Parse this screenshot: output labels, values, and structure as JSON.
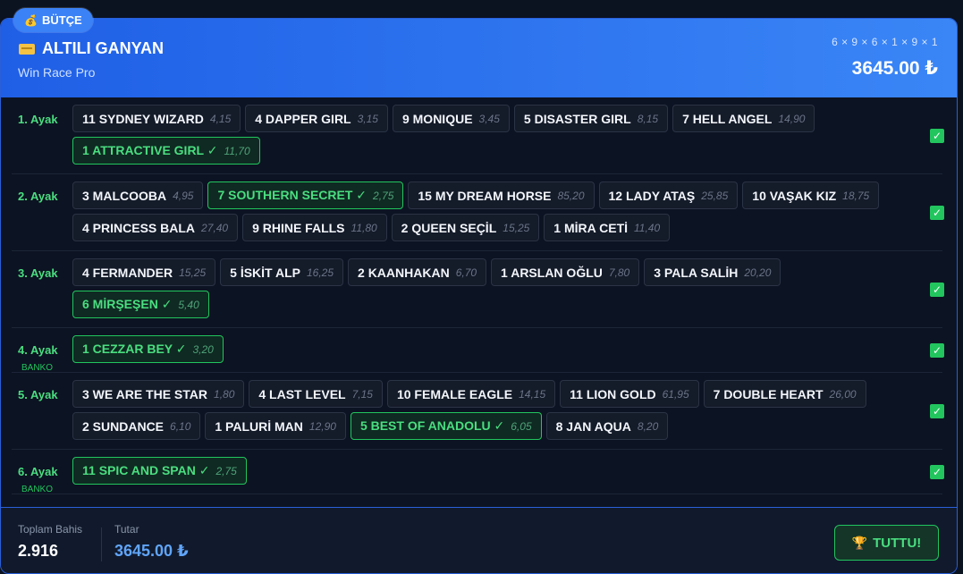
{
  "badge": {
    "icon": "💰",
    "label": "BÜTÇE"
  },
  "header": {
    "title": "ALTILI GANYAN",
    "subtitle": "Win Race Pro",
    "formula": "6 × 9 × 6 × 1 × 9 × 1",
    "total": "3645.00 ₺"
  },
  "legs": [
    {
      "label": "1. Ayak",
      "sub": "",
      "checked": true,
      "horses": [
        {
          "name": "11 SYDNEY WIZARD",
          "odds": "4,15",
          "selected": false
        },
        {
          "name": "4 DAPPER GIRL",
          "odds": "3,15",
          "selected": false
        },
        {
          "name": "9 MONIQUE",
          "odds": "3,45",
          "selected": false
        },
        {
          "name": "5 DISASTER GIRL",
          "odds": "8,15",
          "selected": false
        },
        {
          "name": "7 HELL ANGEL",
          "odds": "14,90",
          "selected": false
        },
        {
          "name": "1 ATTRACTIVE GIRL ✓",
          "odds": "11,70",
          "selected": true
        }
      ]
    },
    {
      "label": "2. Ayak",
      "sub": "",
      "checked": true,
      "horses": [
        {
          "name": "3 MALCOOBA",
          "odds": "4,95",
          "selected": false
        },
        {
          "name": "7 SOUTHERN SECRET ✓",
          "odds": "2,75",
          "selected": true
        },
        {
          "name": "15 MY DREAM HORSE",
          "odds": "85,20",
          "selected": false
        },
        {
          "name": "12 LADY ATAŞ",
          "odds": "25,85",
          "selected": false
        },
        {
          "name": "10 VAŞAK KIZ",
          "odds": "18,75",
          "selected": false
        },
        {
          "name": "4 PRINCESS BALA",
          "odds": "27,40",
          "selected": false
        },
        {
          "name": "9 RHINE FALLS",
          "odds": "11,80",
          "selected": false
        },
        {
          "name": "2 QUEEN SEÇİL",
          "odds": "15,25",
          "selected": false
        },
        {
          "name": "1 MİRA CETİ",
          "odds": "11,40",
          "selected": false
        }
      ]
    },
    {
      "label": "3. Ayak",
      "sub": "",
      "checked": true,
      "horses": [
        {
          "name": "4 FERMANDER",
          "odds": "15,25",
          "selected": false
        },
        {
          "name": "5 İSKİT ALP",
          "odds": "16,25",
          "selected": false
        },
        {
          "name": "2 KAANHAKAN",
          "odds": "6,70",
          "selected": false
        },
        {
          "name": "1 ARSLAN OĞLU",
          "odds": "7,80",
          "selected": false
        },
        {
          "name": "3 PALA SALİH",
          "odds": "20,20",
          "selected": false
        },
        {
          "name": "6 MİRŞEŞEN ✓",
          "odds": "5,40",
          "selected": true
        }
      ]
    },
    {
      "label": "4. Ayak",
      "sub": "BANKO",
      "checked": true,
      "horses": [
        {
          "name": "1 CEZZAR BEY ✓",
          "odds": "3,20",
          "selected": true
        }
      ]
    },
    {
      "label": "5. Ayak",
      "sub": "",
      "checked": true,
      "horses": [
        {
          "name": "3 WE ARE THE STAR",
          "odds": "1,80",
          "selected": false
        },
        {
          "name": "4 LAST LEVEL",
          "odds": "7,15",
          "selected": false
        },
        {
          "name": "10 FEMALE EAGLE",
          "odds": "14,15",
          "selected": false
        },
        {
          "name": "11 LION GOLD",
          "odds": "61,95",
          "selected": false
        },
        {
          "name": "7 DOUBLE HEART",
          "odds": "26,00",
          "selected": false
        },
        {
          "name": "2 SUNDANCE",
          "odds": "6,10",
          "selected": false
        },
        {
          "name": "1 PALURİ MAN",
          "odds": "12,90",
          "selected": false
        },
        {
          "name": "5 BEST OF ANADOLU ✓",
          "odds": "6,05",
          "selected": true
        },
        {
          "name": "8 JAN AQUA",
          "odds": "8,20",
          "selected": false
        }
      ]
    },
    {
      "label": "6. Ayak",
      "sub": "BANKO",
      "checked": true,
      "horses": [
        {
          "name": "11 SPIC AND SPAN ✓",
          "odds": "2,75",
          "selected": true
        }
      ]
    }
  ],
  "footer": {
    "bets_label": "Toplam Bahis",
    "bets_value": "2.916",
    "amount_label": "Tutar",
    "amount_value": "3645.00 ₺",
    "button_label": "TUTTU!",
    "button_icon": "🏆"
  },
  "colors": {
    "accent": "#3a86f6",
    "selected": "#22c55e",
    "amount": "#60a5fa"
  }
}
